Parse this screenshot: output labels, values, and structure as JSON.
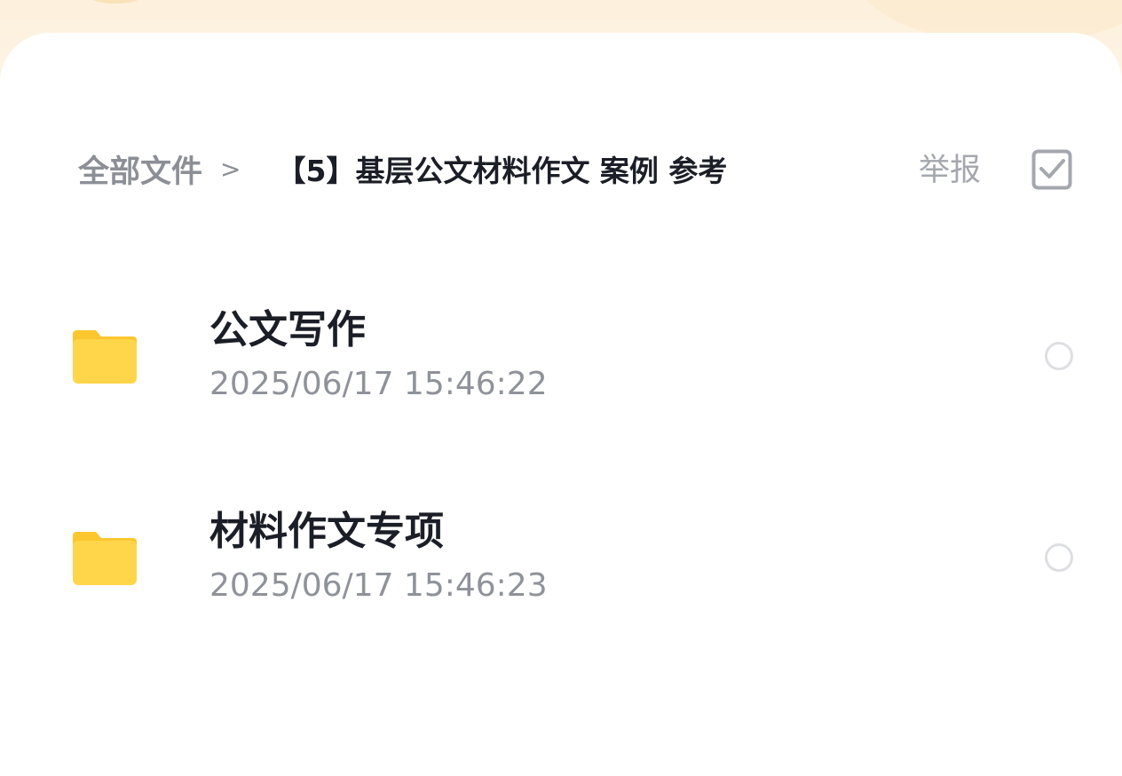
{
  "breadcrumb": {
    "root": "全部文件",
    "separator": ">",
    "current": "【5】基层公文材料作文 案例 参考"
  },
  "header": {
    "report_label": "举报",
    "select_icon": "checkbox-icon"
  },
  "files": [
    {
      "name": "公文写作",
      "time": "2025/06/17 15:46:22",
      "icon": "folder-icon"
    },
    {
      "name": "材料作文专项",
      "time": "2025/06/17 15:46:23",
      "icon": "folder-icon"
    }
  ],
  "colors": {
    "folder": "#ffd54a",
    "folder_tab": "#fcc62e",
    "title": "#1b1e26",
    "muted": "#8f9299"
  }
}
